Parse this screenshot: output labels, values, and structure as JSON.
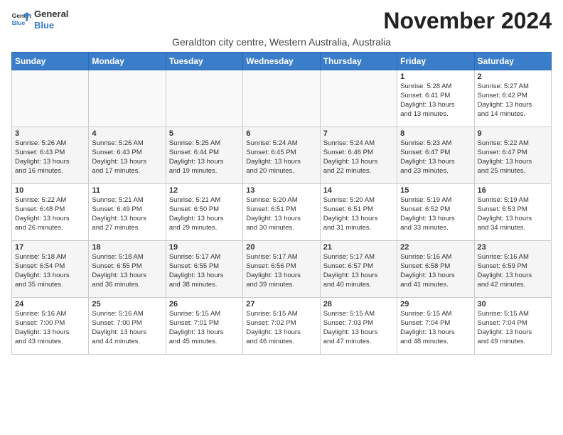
{
  "logo": {
    "general": "General",
    "blue": "Blue"
  },
  "title": "November 2024",
  "location": "Geraldton city centre, Western Australia, Australia",
  "days_header": [
    "Sunday",
    "Monday",
    "Tuesday",
    "Wednesday",
    "Thursday",
    "Friday",
    "Saturday"
  ],
  "weeks": [
    [
      {
        "day": "",
        "info": ""
      },
      {
        "day": "",
        "info": ""
      },
      {
        "day": "",
        "info": ""
      },
      {
        "day": "",
        "info": ""
      },
      {
        "day": "",
        "info": ""
      },
      {
        "day": "1",
        "info": "Sunrise: 5:28 AM\nSunset: 6:41 PM\nDaylight: 13 hours\nand 13 minutes."
      },
      {
        "day": "2",
        "info": "Sunrise: 5:27 AM\nSunset: 6:42 PM\nDaylight: 13 hours\nand 14 minutes."
      }
    ],
    [
      {
        "day": "3",
        "info": "Sunrise: 5:26 AM\nSunset: 6:43 PM\nDaylight: 13 hours\nand 16 minutes."
      },
      {
        "day": "4",
        "info": "Sunrise: 5:26 AM\nSunset: 6:43 PM\nDaylight: 13 hours\nand 17 minutes."
      },
      {
        "day": "5",
        "info": "Sunrise: 5:25 AM\nSunset: 6:44 PM\nDaylight: 13 hours\nand 19 minutes."
      },
      {
        "day": "6",
        "info": "Sunrise: 5:24 AM\nSunset: 6:45 PM\nDaylight: 13 hours\nand 20 minutes."
      },
      {
        "day": "7",
        "info": "Sunrise: 5:24 AM\nSunset: 6:46 PM\nDaylight: 13 hours\nand 22 minutes."
      },
      {
        "day": "8",
        "info": "Sunrise: 5:23 AM\nSunset: 6:47 PM\nDaylight: 13 hours\nand 23 minutes."
      },
      {
        "day": "9",
        "info": "Sunrise: 5:22 AM\nSunset: 6:47 PM\nDaylight: 13 hours\nand 25 minutes."
      }
    ],
    [
      {
        "day": "10",
        "info": "Sunrise: 5:22 AM\nSunset: 6:48 PM\nDaylight: 13 hours\nand 26 minutes."
      },
      {
        "day": "11",
        "info": "Sunrise: 5:21 AM\nSunset: 6:49 PM\nDaylight: 13 hours\nand 27 minutes."
      },
      {
        "day": "12",
        "info": "Sunrise: 5:21 AM\nSunset: 6:50 PM\nDaylight: 13 hours\nand 29 minutes."
      },
      {
        "day": "13",
        "info": "Sunrise: 5:20 AM\nSunset: 6:51 PM\nDaylight: 13 hours\nand 30 minutes."
      },
      {
        "day": "14",
        "info": "Sunrise: 5:20 AM\nSunset: 6:51 PM\nDaylight: 13 hours\nand 31 minutes."
      },
      {
        "day": "15",
        "info": "Sunrise: 5:19 AM\nSunset: 6:52 PM\nDaylight: 13 hours\nand 33 minutes."
      },
      {
        "day": "16",
        "info": "Sunrise: 5:19 AM\nSunset: 6:53 PM\nDaylight: 13 hours\nand 34 minutes."
      }
    ],
    [
      {
        "day": "17",
        "info": "Sunrise: 5:18 AM\nSunset: 6:54 PM\nDaylight: 13 hours\nand 35 minutes."
      },
      {
        "day": "18",
        "info": "Sunrise: 5:18 AM\nSunset: 6:55 PM\nDaylight: 13 hours\nand 36 minutes."
      },
      {
        "day": "19",
        "info": "Sunrise: 5:17 AM\nSunset: 6:55 PM\nDaylight: 13 hours\nand 38 minutes."
      },
      {
        "day": "20",
        "info": "Sunrise: 5:17 AM\nSunset: 6:56 PM\nDaylight: 13 hours\nand 39 minutes."
      },
      {
        "day": "21",
        "info": "Sunrise: 5:17 AM\nSunset: 6:57 PM\nDaylight: 13 hours\nand 40 minutes."
      },
      {
        "day": "22",
        "info": "Sunrise: 5:16 AM\nSunset: 6:58 PM\nDaylight: 13 hours\nand 41 minutes."
      },
      {
        "day": "23",
        "info": "Sunrise: 5:16 AM\nSunset: 6:59 PM\nDaylight: 13 hours\nand 42 minutes."
      }
    ],
    [
      {
        "day": "24",
        "info": "Sunrise: 5:16 AM\nSunset: 7:00 PM\nDaylight: 13 hours\nand 43 minutes."
      },
      {
        "day": "25",
        "info": "Sunrise: 5:16 AM\nSunset: 7:00 PM\nDaylight: 13 hours\nand 44 minutes."
      },
      {
        "day": "26",
        "info": "Sunrise: 5:15 AM\nSunset: 7:01 PM\nDaylight: 13 hours\nand 45 minutes."
      },
      {
        "day": "27",
        "info": "Sunrise: 5:15 AM\nSunset: 7:02 PM\nDaylight: 13 hours\nand 46 minutes."
      },
      {
        "day": "28",
        "info": "Sunrise: 5:15 AM\nSunset: 7:03 PM\nDaylight: 13 hours\nand 47 minutes."
      },
      {
        "day": "29",
        "info": "Sunrise: 5:15 AM\nSunset: 7:04 PM\nDaylight: 13 hours\nand 48 minutes."
      },
      {
        "day": "30",
        "info": "Sunrise: 5:15 AM\nSunset: 7:04 PM\nDaylight: 13 hours\nand 49 minutes."
      }
    ]
  ]
}
